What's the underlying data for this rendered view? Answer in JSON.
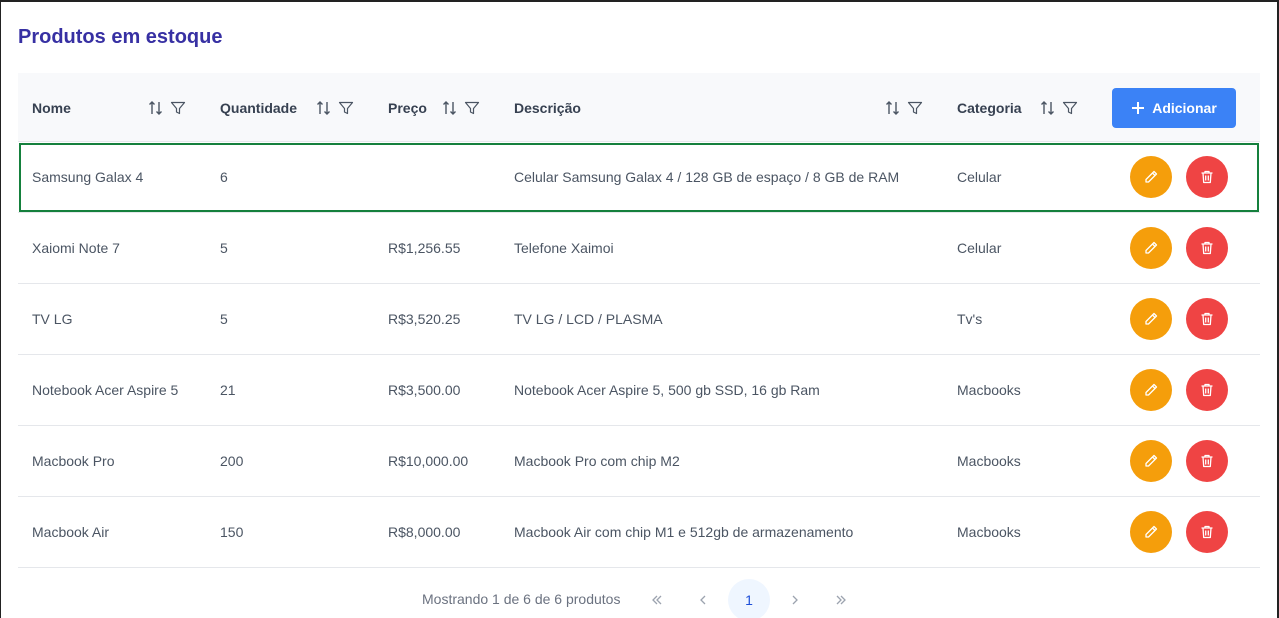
{
  "page": {
    "title": "Produtos em estoque"
  },
  "table": {
    "columns": {
      "nome": "Nome",
      "quantidade": "Quantidade",
      "preco": "Preço",
      "descricao": "Descrição",
      "categoria": "Categoria"
    },
    "add_button_label": "Adicionar",
    "rows": [
      {
        "nome": "Samsung Galax 4",
        "quantidade": "6",
        "preco": "",
        "descricao": "Celular Samsung Galax 4 / 128 GB de espaço / 8 GB de RAM",
        "categoria": "Celular"
      },
      {
        "nome": "Xaiomi Note 7",
        "quantidade": "5",
        "preco": "R$1,256.55",
        "descricao": "Telefone Xaimoi",
        "categoria": "Celular"
      },
      {
        "nome": "TV LG",
        "quantidade": "5",
        "preco": "R$3,520.25",
        "descricao": "TV LG / LCD / PLASMA",
        "categoria": "Tv's"
      },
      {
        "nome": "Notebook Acer Aspire 5",
        "quantidade": "21",
        "preco": "R$3,500.00",
        "descricao": "Notebook Acer Aspire 5, 500 gb SSD, 16 gb Ram",
        "categoria": "Macbooks"
      },
      {
        "nome": "Macbook Pro",
        "quantidade": "200",
        "preco": "R$10,000.00",
        "descricao": "Macbook Pro com chip M2",
        "categoria": "Macbooks"
      },
      {
        "nome": "Macbook Air",
        "quantidade": "150",
        "preco": "R$8,000.00",
        "descricao": "Macbook Air com chip M1 e 512gb de armazenamento",
        "categoria": "Macbooks"
      }
    ]
  },
  "pagination": {
    "info": "Mostrando 1 de 6 de 6 produtos",
    "current_page": "1"
  },
  "colors": {
    "title": "#3730a3",
    "add_button": "#3b82f6",
    "edit_button": "#f59e0b",
    "delete_button": "#ef4444",
    "selected_row_outline": "#15803d"
  }
}
